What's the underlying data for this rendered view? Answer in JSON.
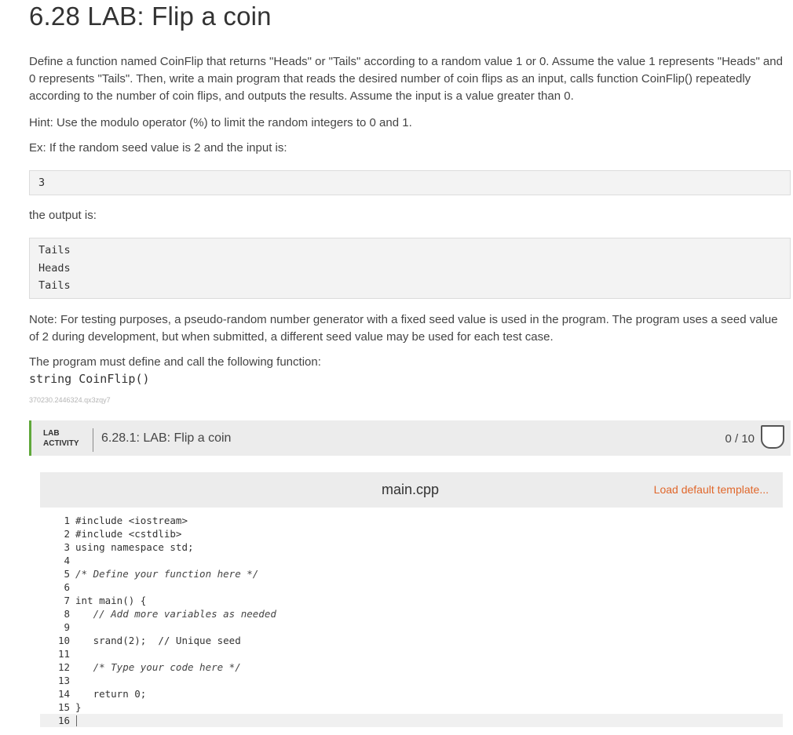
{
  "title": "6.28 LAB: Flip a coin",
  "description": "Define a function named CoinFlip that returns \"Heads\" or \"Tails\" according to a random value 1 or 0. Assume the value 1 represents \"Heads\" and 0 represents \"Tails\". Then, write a main program that reads the desired number of coin flips as an input, calls function CoinFlip() repeatedly according to the number of coin flips, and outputs the results. Assume the input is a value greater than 0.",
  "hint": "Hint: Use the modulo operator (%) to limit the random integers to 0 and 1.",
  "example_intro": "Ex: If the random seed value is 2 and the input is:",
  "example_input": [
    "3"
  ],
  "output_intro": "the output is:",
  "example_output": [
    "Tails",
    "Heads",
    "Tails"
  ],
  "note": "Note: For testing purposes, a pseudo-random number generator with a fixed seed value is used in the program. The program uses a seed value of 2 during development, but when submitted, a different seed value may be used for each test case.",
  "must_define": "The program must define and call the following function:",
  "signature": "string CoinFlip()",
  "small_id": "370230.2446324.qx3zqy7",
  "lab": {
    "tag_line1": "LAB",
    "tag_line2": "ACTIVITY",
    "name": "6.28.1: LAB: Flip a coin",
    "score": "0 / 10"
  },
  "editor": {
    "file_name": "main.cpp",
    "load_template": "Load default template...",
    "lines": [
      {
        "n": "1",
        "code": "#include <iostream>"
      },
      {
        "n": "2",
        "code": "#include <cstdlib>"
      },
      {
        "n": "3",
        "code": "using namespace std;"
      },
      {
        "n": "4",
        "code": ""
      },
      {
        "n": "5",
        "code": "/* Define your function here */"
      },
      {
        "n": "6",
        "code": ""
      },
      {
        "n": "7",
        "code": "int main() {"
      },
      {
        "n": "8",
        "code": "   // Add more variables as needed"
      },
      {
        "n": "9",
        "code": ""
      },
      {
        "n": "10",
        "code": "   srand(2);  // Unique seed"
      },
      {
        "n": "11",
        "code": ""
      },
      {
        "n": "12",
        "code": "   /* Type your code here */"
      },
      {
        "n": "13",
        "code": ""
      },
      {
        "n": "14",
        "code": "   return 0;"
      },
      {
        "n": "15",
        "code": "}"
      },
      {
        "n": "16",
        "code": ""
      }
    ]
  }
}
